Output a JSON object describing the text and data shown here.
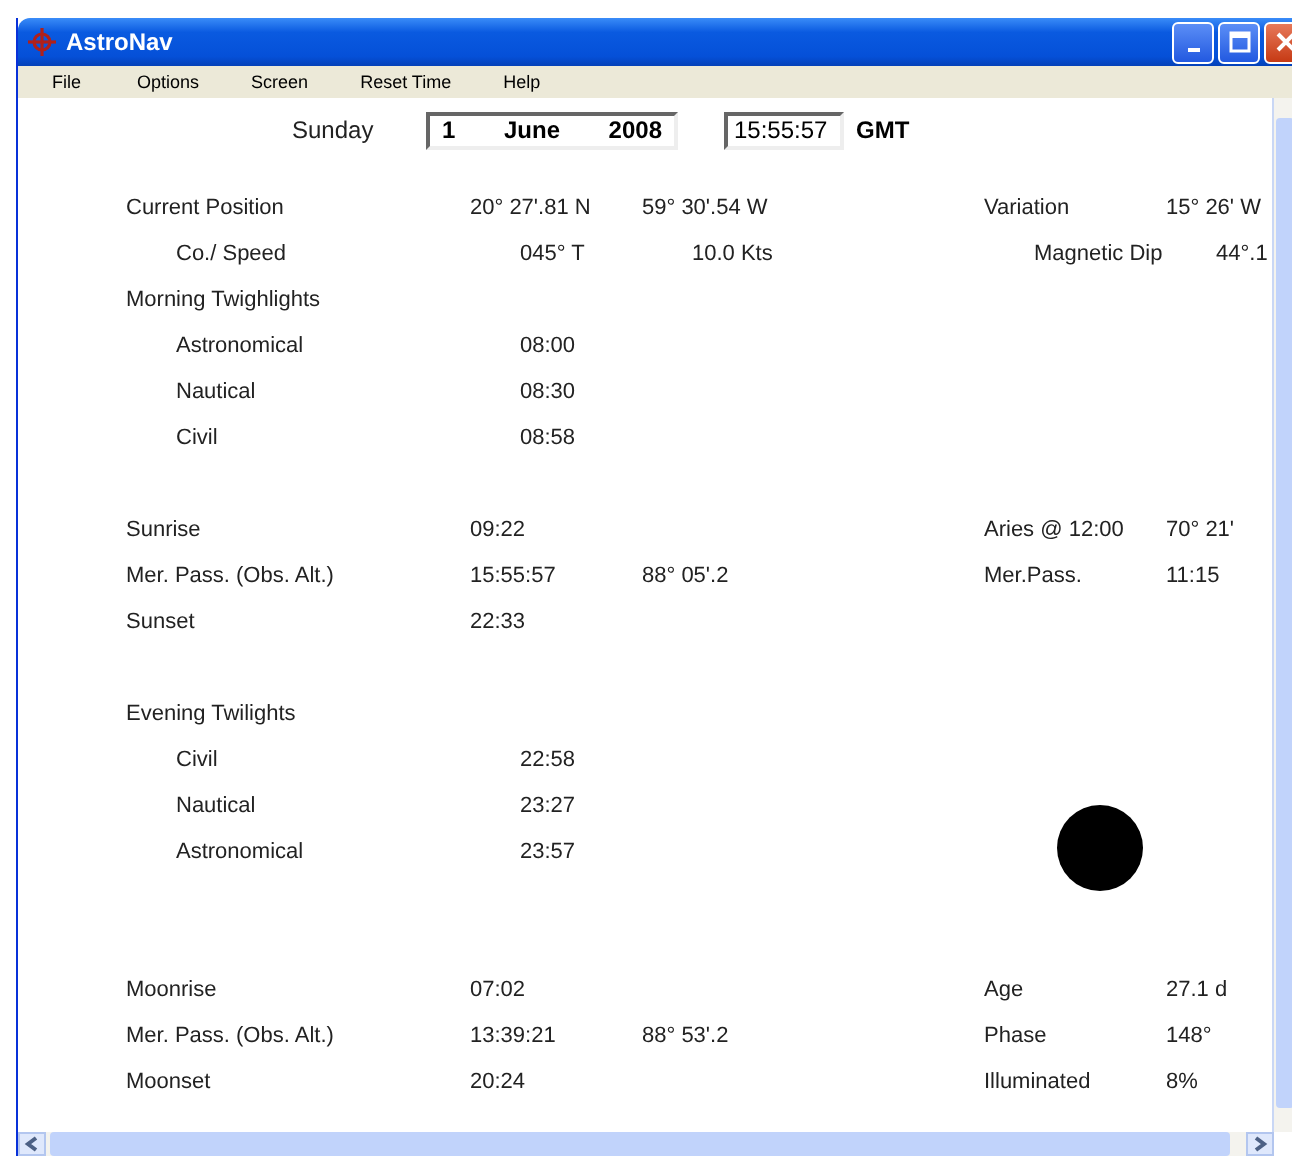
{
  "window": {
    "title": "AstroNav"
  },
  "menu": [
    "File",
    "Options",
    "Screen",
    "Reset Time",
    "Help"
  ],
  "date": {
    "weekday": "Sunday",
    "day": "1",
    "month": "June",
    "year": "2008",
    "time": "15:55:57",
    "zone": "GMT"
  },
  "sections": [
    {
      "rows": [
        {
          "label": "Current Position",
          "values": [
            "20° 27'.81 N",
            "59° 30'.54 W"
          ],
          "right_label": "Variation",
          "right_value": "15° 26' W",
          "children": [
            {
              "label": "Co./ Speed",
              "values": [
                "045° T",
                "10.0 Kts"
              ],
              "right_label": "Magnetic Dip",
              "right_value": "44°.1"
            }
          ]
        },
        {
          "label": "Morning Twighlights",
          "children": [
            {
              "label": "Astronomical",
              "values": [
                "08:00"
              ]
            },
            {
              "label": "Nautical",
              "values": [
                "08:30"
              ]
            },
            {
              "label": "Civil",
              "values": [
                "08:58"
              ]
            }
          ]
        }
      ]
    },
    {
      "rows": [
        {
          "label": "Sunrise",
          "values": [
            "09:22"
          ],
          "right_label": "Aries @ 12:00",
          "right_value": "70° 21'"
        },
        {
          "label": "Mer. Pass. (Obs. Alt.)",
          "values": [
            "15:55:57",
            "88° 05'.2"
          ],
          "right_label": "Mer.Pass.",
          "right_value": "11:15"
        },
        {
          "label": "Sunset",
          "values": [
            "22:33"
          ]
        }
      ]
    },
    {
      "moon": true,
      "rows": [
        {
          "label": "Evening Twilights",
          "children": [
            {
              "label": "Civil",
              "values": [
                "22:58"
              ]
            },
            {
              "label": "Nautical",
              "values": [
                "23:27"
              ]
            },
            {
              "label": "Astronomical",
              "values": [
                "23:57"
              ]
            }
          ]
        }
      ]
    },
    {
      "rows": [
        {
          "label": "Moonrise",
          "values": [
            "07:02"
          ],
          "right_label": "Age",
          "right_value": "27.1 d"
        },
        {
          "label": "Mer. Pass. (Obs. Alt.)",
          "values": [
            "13:39:21",
            "88° 53'.2"
          ],
          "right_label": "Phase",
          "right_value": "148°"
        },
        {
          "label": "Moonset",
          "values": [
            "20:24"
          ],
          "right_label": "Illuminated",
          "right_value": "8%"
        }
      ]
    }
  ]
}
